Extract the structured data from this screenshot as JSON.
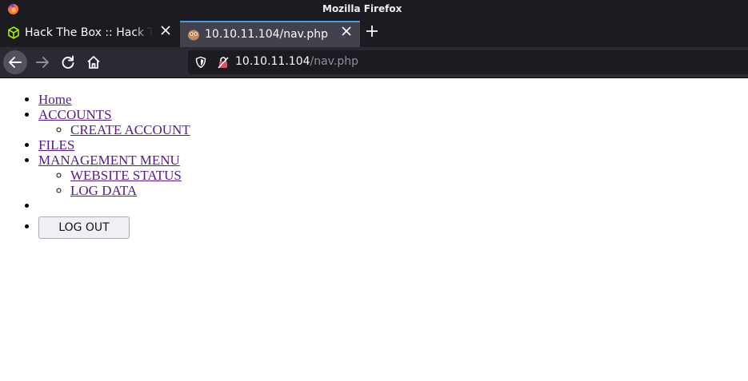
{
  "window": {
    "title": "Mozilla Firefox",
    "logo_icon": "firefox-icon"
  },
  "tabs": [
    {
      "label": "Hack The Box :: Hack The Box",
      "icon": "hackthebox-cube-icon",
      "active": false
    },
    {
      "label": "10.10.11.104/nav.php",
      "icon": "owl-favicon-icon",
      "active": true
    }
  ],
  "toolbar": {
    "back_icon": "back-arrow-icon",
    "forward_icon": "forward-arrow-icon",
    "reload_icon": "reload-icon",
    "home_icon": "home-icon"
  },
  "urlbar": {
    "host": "10.10.11.104",
    "path": "/nav.php",
    "shield_icon": "tracking-shield-icon",
    "security_icon": "insecure-lock-icon"
  },
  "nav": {
    "home": "Home",
    "accounts": "ACCOUNTS",
    "create_account": "CREATE ACCOUNT",
    "files": "FILES",
    "management_menu": "MANAGEMENT MENU",
    "website_status": "WEBSITE STATUS",
    "log_data": "LOG DATA",
    "logout": "LOG OUT"
  },
  "colors": {
    "visited_link": "#551a8b",
    "tab_accent": "#4a9ae9",
    "chrome_dark": "#1c1b22"
  }
}
